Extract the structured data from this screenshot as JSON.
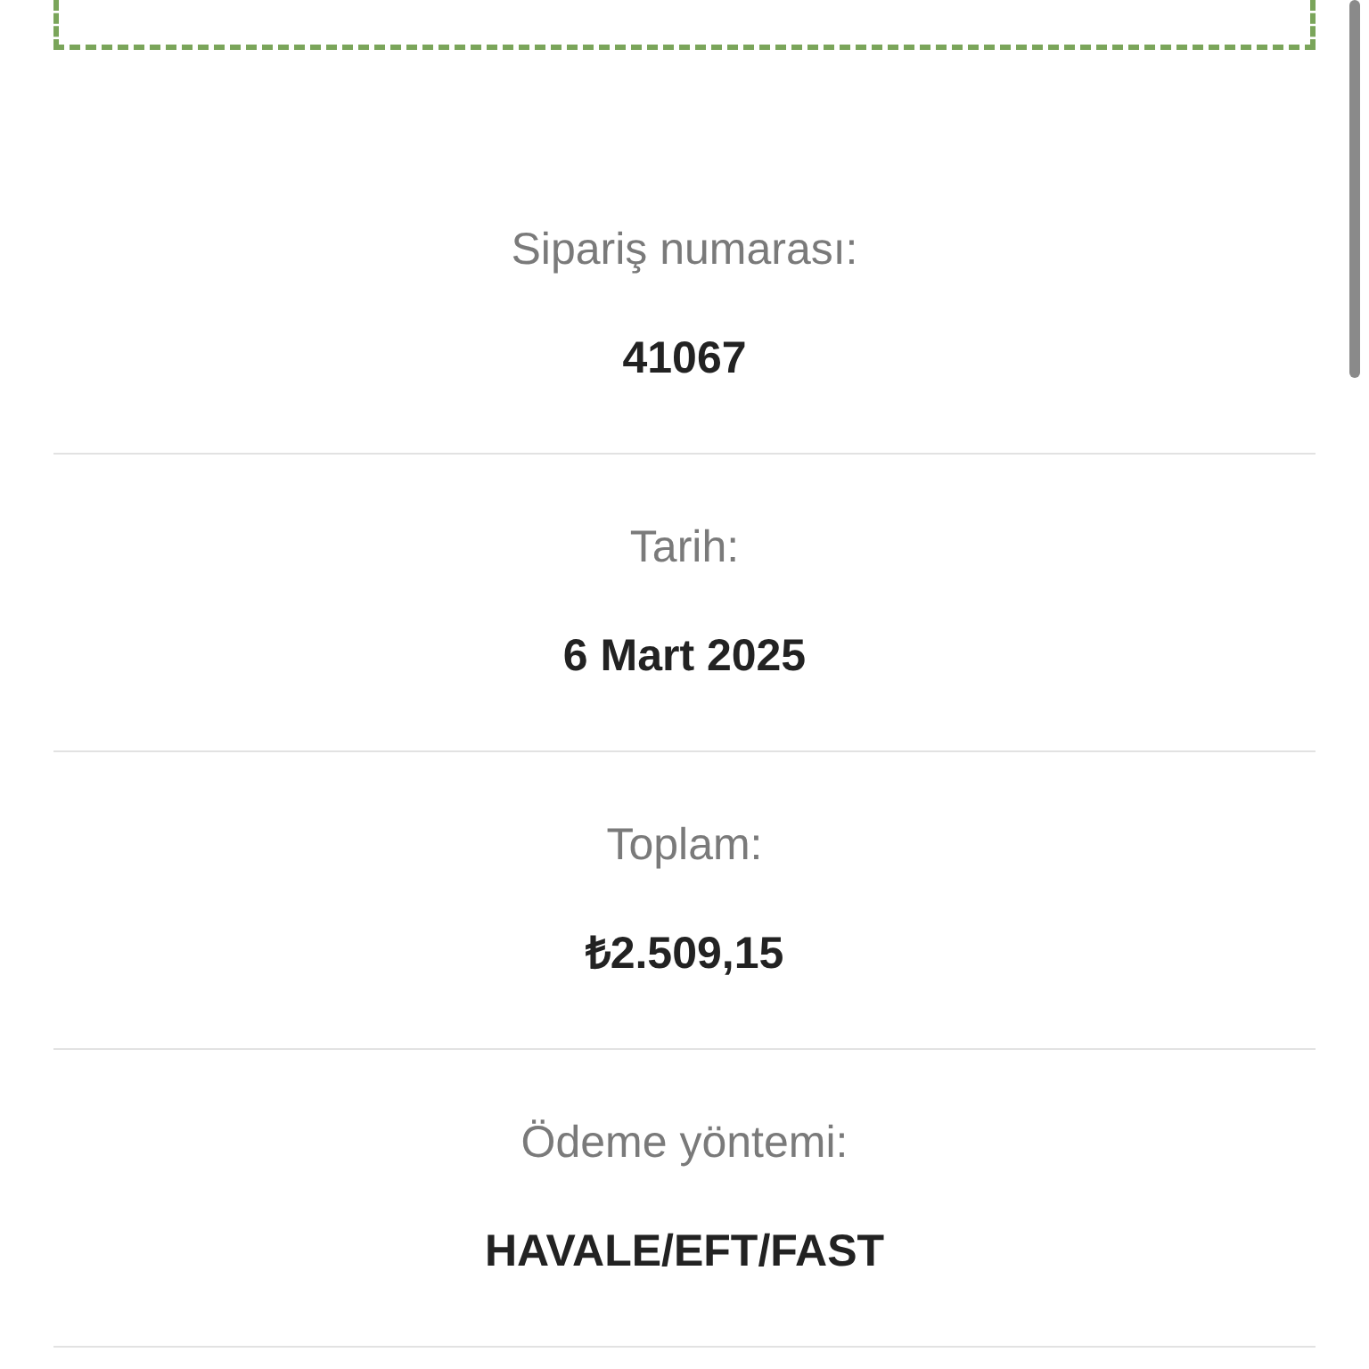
{
  "order_details": [
    {
      "label": "Sipariş numarası:",
      "value": "41067"
    },
    {
      "label": "Tarih:",
      "value": "6 Mart 2025"
    },
    {
      "label": "Toplam:",
      "value": "₺2.509,15"
    },
    {
      "label": "Ödeme yöntemi:",
      "value": "HAVALE/EFT/FAST"
    }
  ]
}
